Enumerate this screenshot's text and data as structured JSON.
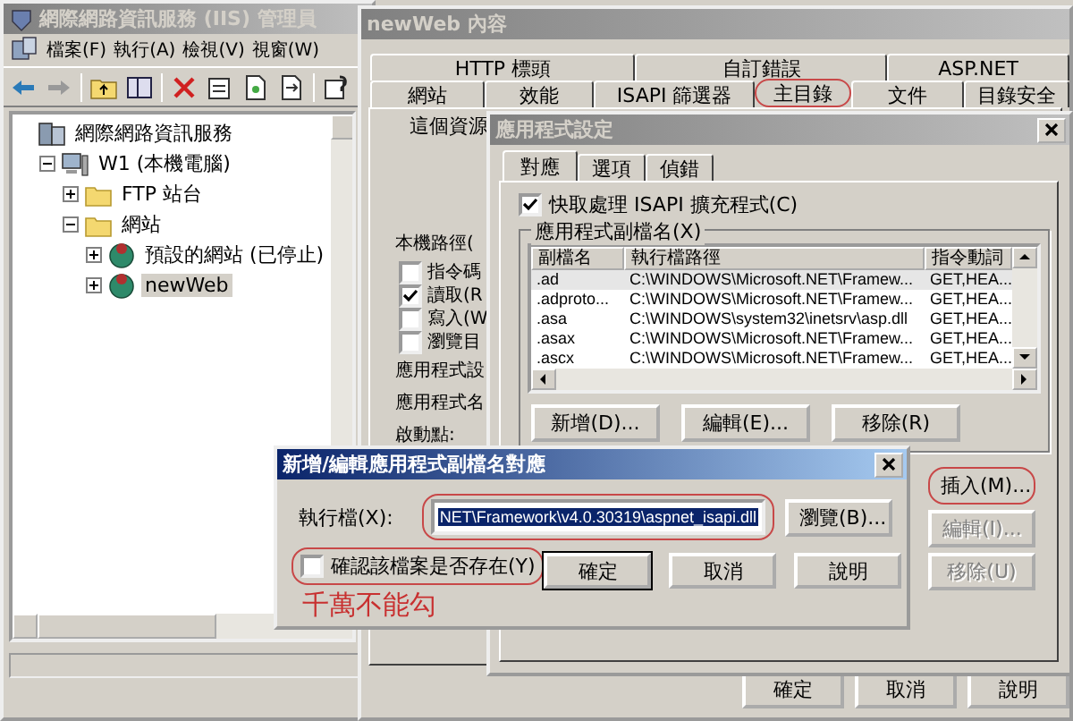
{
  "main_window": {
    "title": "網際網路資訊服務 (IIS) 管理員",
    "menu": [
      "檔案(F)",
      "執行(A)",
      "檢視(V)",
      "視窗(W)"
    ],
    "tree": [
      {
        "label": "網際網路資訊服務",
        "kind": "services",
        "selected": false,
        "children": [
          {
            "label": "W1 (本機電腦)",
            "kind": "computer",
            "expanded": true,
            "selected": false,
            "children": [
              {
                "label": "FTP 站台",
                "kind": "folder",
                "expanded": false,
                "selected": false
              },
              {
                "label": "網站",
                "kind": "folder",
                "expanded": true,
                "selected": false,
                "children": [
                  {
                    "label": "預設的網站 (已停止)",
                    "kind": "site",
                    "expanded": false,
                    "selected": false
                  },
                  {
                    "label": "newWeb",
                    "kind": "site",
                    "expanded": false,
                    "selected": true
                  }
                ]
              }
            ]
          }
        ]
      }
    ]
  },
  "properties_window": {
    "title": "newWeb 內容",
    "tabs_row_1": [
      {
        "label": "HTTP 標頭",
        "selected": false,
        "circled": false
      },
      {
        "label": "自訂錯誤",
        "selected": false,
        "circled": false
      },
      {
        "label": "ASP.NET",
        "selected": false,
        "circled": false
      }
    ],
    "tabs_row_2": [
      {
        "label": "網站",
        "selected": false,
        "circled": false
      },
      {
        "label": "效能",
        "selected": false,
        "circled": false
      },
      {
        "label": "ISAPI 篩選器",
        "selected": false,
        "circled": false
      },
      {
        "label": "主目錄",
        "selected": true,
        "circled": true
      },
      {
        "label": "文件",
        "selected": false,
        "circled": false
      },
      {
        "label": "目錄安全",
        "selected": false,
        "circled": false
      }
    ],
    "intro": "這個資源",
    "local_path_label": "本機路徑(",
    "permissions": [
      {
        "label": "指令碼",
        "checked": false
      },
      {
        "label": "讀取(R",
        "checked": true
      },
      {
        "label": "寫入(W",
        "checked": false
      },
      {
        "label": "瀏覽目",
        "checked": false
      }
    ],
    "app_settings_label": "應用程式設",
    "app_name_label": "應用程式名",
    "start_point_label": "啟動點:",
    "buttons": [
      "確定",
      "取消",
      "說明"
    ]
  },
  "app_settings_dialog": {
    "title": "應用程式設定",
    "tabs": [
      {
        "label": "對應",
        "selected": true
      },
      {
        "label": "選項",
        "selected": false
      },
      {
        "label": "偵錯",
        "selected": false
      }
    ],
    "cache_checkbox": {
      "label": "快取處理 ISAPI 擴充程式(C)",
      "checked": true
    },
    "group_label": "應用程式副檔名(X)",
    "columns": [
      "副檔名",
      "執行檔路徑",
      "指令動詞"
    ],
    "rows": [
      {
        "cells": [
          ".ad",
          "C:\\WINDOWS\\Microsoft.NET\\Framew...",
          "GET,HEA..."
        ],
        "selected": true
      },
      {
        "cells": [
          ".adproto...",
          "C:\\WINDOWS\\Microsoft.NET\\Framew...",
          "GET,HEA..."
        ],
        "selected": false
      },
      {
        "cells": [
          ".asa",
          "C:\\WINDOWS\\system32\\inetsrv\\asp.dll",
          "GET,HEA..."
        ],
        "selected": false
      },
      {
        "cells": [
          ".asax",
          "C:\\WINDOWS\\Microsoft.NET\\Framew...",
          "GET,HEA..."
        ],
        "selected": false
      },
      {
        "cells": [
          ".ascx",
          "C:\\WINDOWS\\Microsoft.NET\\Framew...",
          "GET,HEA..."
        ],
        "selected": false
      }
    ],
    "list_buttons": [
      "新增(D)...",
      "編輯(E)...",
      "移除(R)"
    ],
    "side_buttons": [
      {
        "label": "插入(M)...",
        "disabled": false,
        "circled": true
      },
      {
        "label": "編輯(I)...",
        "disabled": true,
        "circled": false
      },
      {
        "label": "移除(U)",
        "disabled": true,
        "circled": false
      }
    ]
  },
  "mapping_dialog": {
    "title": "新增/編輯應用程式副檔名對應",
    "executable_label": "執行檔(X):",
    "executable_value": "NET\\Framework\\v4.0.30319\\aspnet_isapi.dll",
    "executable_circled": true,
    "browse_button": "瀏覽(B)...",
    "verify_checkbox": {
      "label": "確認該檔案是否存在(Y)",
      "checked": false,
      "circled": true
    },
    "annotation": "千萬不能勾",
    "buttons": [
      {
        "label": "確定",
        "default": true
      },
      {
        "label": "取消",
        "default": false
      },
      {
        "label": "說明",
        "default": false
      }
    ]
  }
}
